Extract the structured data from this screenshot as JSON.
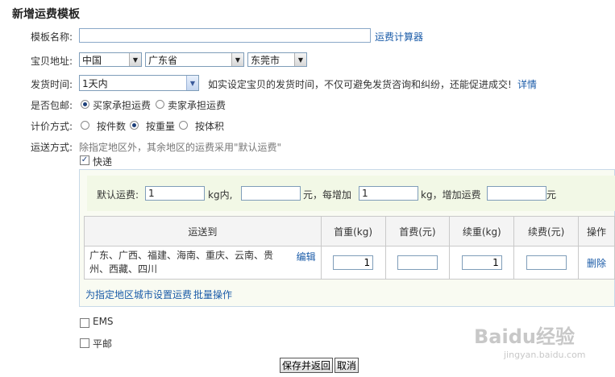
{
  "page_title": "新增运费模板",
  "template_name": {
    "label": "模板名称:",
    "value": "",
    "calculator_link": "运费计算器"
  },
  "location": {
    "label": "宝贝地址:",
    "country": "中国",
    "province": "广东省",
    "city": "东莞市"
  },
  "ship_time": {
    "label": "发货时间:",
    "value": "1天内",
    "hint": "如实设定宝贝的发货时间，不仅可避免发货咨询和纠纷，还能促进成交!",
    "detail_link": "详情"
  },
  "free_shipping": {
    "label": "是否包邮:",
    "options": [
      "买家承担运费",
      "卖家承担运费"
    ],
    "selected": 0
  },
  "pricing": {
    "label": "计价方式:",
    "options": [
      "按件数",
      "按重量",
      "按体积"
    ],
    "selected": 1
  },
  "delivery": {
    "label": "运送方式:",
    "hint": "除指定地区外，其余地区的运费采用\"默认运费\""
  },
  "express": {
    "label": "快递",
    "checked": true,
    "default_fee": {
      "label": "默认运费:",
      "first_weight": "1",
      "kg_within": "kg内,",
      "first_fee": "",
      "yuan_each": "元，每增加",
      "step_weight": "1",
      "kg_add": "kg，增加运费",
      "add_fee": "",
      "yuan": "元"
    },
    "table": {
      "headers": [
        "运送到",
        "首重(kg)",
        "首费(元)",
        "续重(kg)",
        "续费(元)",
        "操作"
      ],
      "rows": [
        {
          "regions_line1": "广东、广西、福建、海南、重庆、云南、贵",
          "regions_line2": "州、西藏、四川",
          "edit": "编辑",
          "first_weight": "1",
          "first_fee": "",
          "next_weight": "1",
          "next_fee": "",
          "delete": "删除"
        }
      ]
    },
    "set_region_link": "为指定地区城市设置运费",
    "batch_link": "批量操作"
  },
  "ems": {
    "label": "EMS",
    "checked": false
  },
  "surface_mail": {
    "label": "平邮",
    "checked": false
  },
  "buttons": {
    "save": "保存并返回",
    "cancel": "取消"
  },
  "watermark": {
    "brand": "Baidu经验",
    "url": "jingyan.baidu.com"
  }
}
